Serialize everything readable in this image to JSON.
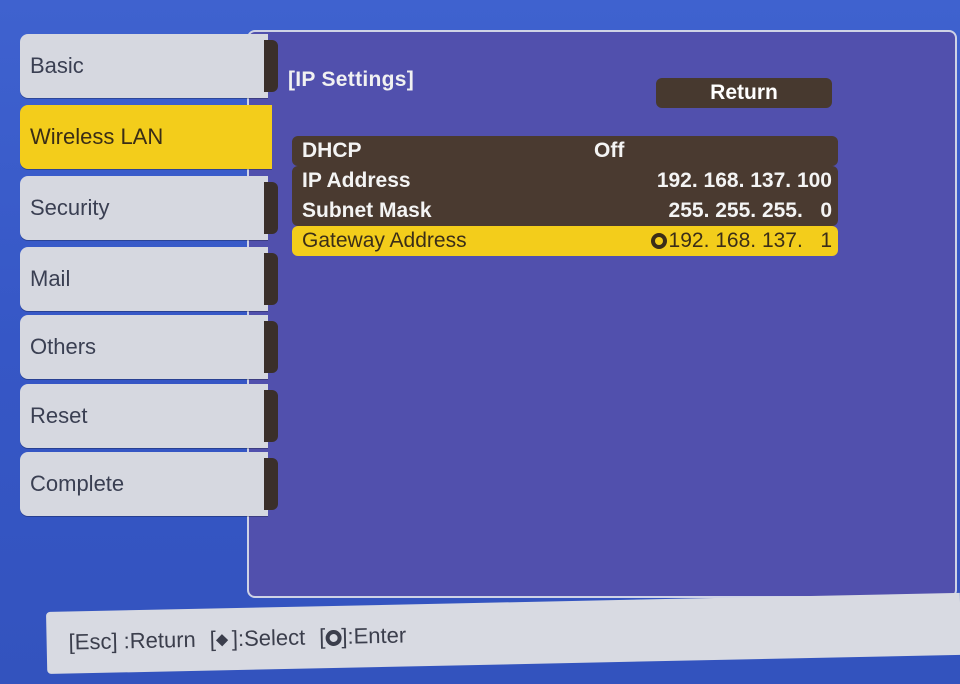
{
  "sidebar": {
    "tabs": [
      {
        "label": "Basic",
        "active": false
      },
      {
        "label": "Wireless LAN",
        "active": true
      },
      {
        "label": "Security",
        "active": false
      },
      {
        "label": "Mail",
        "active": false
      },
      {
        "label": "Others",
        "active": false
      },
      {
        "label": "Reset",
        "active": false
      },
      {
        "label": "Complete",
        "active": false
      }
    ]
  },
  "panel": {
    "title": "[IP Settings]",
    "return_label": "Return",
    "settings": [
      {
        "label": "DHCP",
        "value": "Off"
      },
      {
        "label": "IP Address",
        "value": "192. 168. 137. 100"
      },
      {
        "label": "Subnet Mask",
        "value": "255. 255. 255.   0"
      },
      {
        "label": "Gateway Address",
        "value": "192. 168. 137.   1",
        "selected": true
      }
    ]
  },
  "footer": {
    "esc": "[Esc] :Return",
    "select_prefix": "[",
    "select_suffix": "]:Select",
    "enter_prefix": "[",
    "enter_suffix": "]:Enter"
  },
  "colors": {
    "background": "#3a5cc8",
    "panel": "#5150ad",
    "highlight": "#f3cd1b",
    "dark_band": "#4a3a30",
    "tab": "#d6d8e0"
  },
  "icons": {
    "select": "up-down-arrows-icon",
    "enter": "enter-icon"
  }
}
